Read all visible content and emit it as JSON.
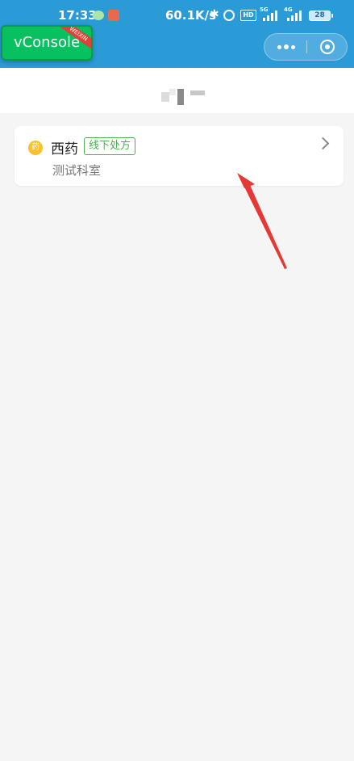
{
  "status_bar": {
    "time": "17:33",
    "net_speed": "60.1K/s",
    "hd_label": "HD",
    "signal1_label": "5G",
    "signal2_label": "4G",
    "battery": "28"
  },
  "vconsole": {
    "label": "vConsole",
    "ribbon": "WEIXIN"
  },
  "capsule": {
    "more_icon": "more-dots-icon",
    "close_icon": "circle-close-icon"
  },
  "prescription_card": {
    "icon_text": "药",
    "drug_type": "西药",
    "tag": "线下处方",
    "department": "测试科室"
  },
  "colors": {
    "header_bg": "#2b9bd8",
    "vconsole_bg": "#07c160",
    "tag_green": "#4caf50",
    "drug_icon": "#fbc02d",
    "annotation_arrow": "#e53935"
  }
}
